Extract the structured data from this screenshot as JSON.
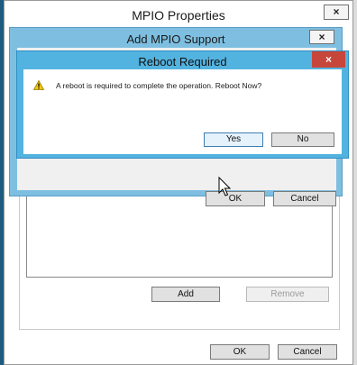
{
  "mpio_window": {
    "title": "MPIO Properties",
    "close_glyph": "×",
    "buttons": {
      "add": "Add",
      "remove": "Remove",
      "ok": "OK",
      "cancel": "Cancel"
    }
  },
  "add_dialog": {
    "title": "Add MPIO Support",
    "close_glyph": "×",
    "buttons": {
      "ok": "OK",
      "cancel": "Cancel"
    }
  },
  "reboot_dialog": {
    "title": "Reboot Required",
    "close_glyph": "×",
    "icon": "warning-icon",
    "message": "A reboot is required to complete the operation. Reboot Now?",
    "buttons": {
      "yes": "Yes",
      "no": "No"
    }
  },
  "colors": {
    "reboot_frame": "#53b3e0",
    "add_frame": "#7ebfe1",
    "close_red": "#c7463c"
  }
}
